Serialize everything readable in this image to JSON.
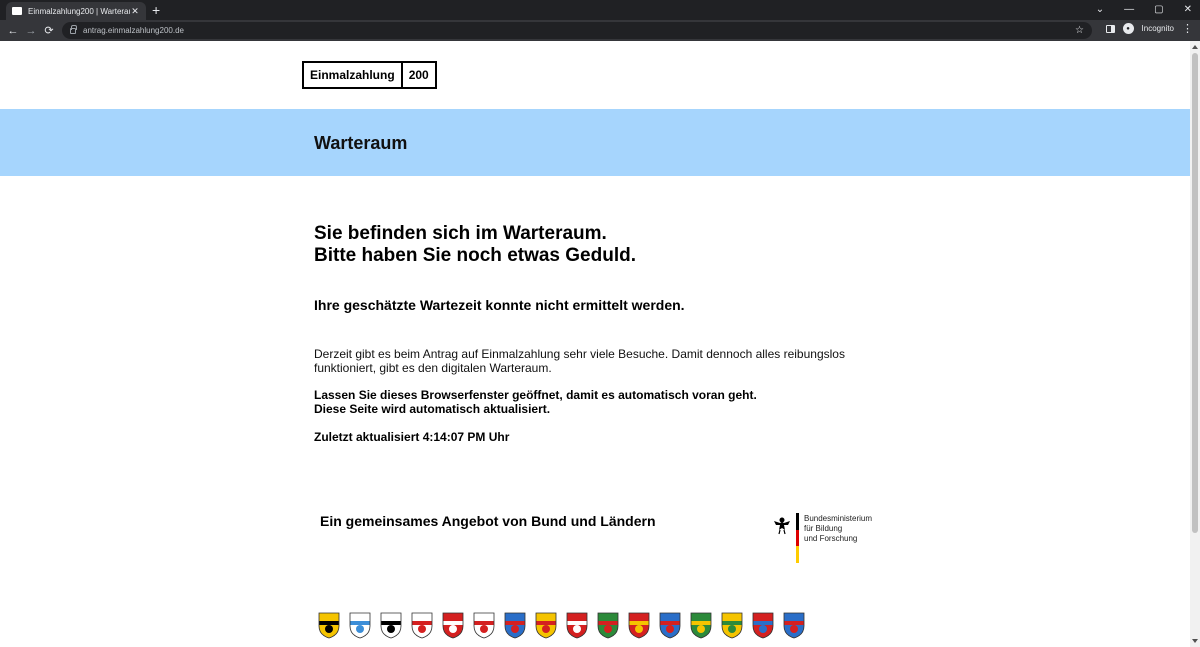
{
  "browser": {
    "tab_title": "Einmalzahlung200 | Warteraum",
    "tab_close": "✕",
    "new_tab": "+",
    "url": "antrag.einmalzahlung200.de",
    "incognito_label": "Incognito",
    "window_controls": [
      "⌄",
      "—",
      "▢",
      "✕"
    ],
    "nav": {
      "back": "←",
      "forward": "→",
      "reload": "⟳",
      "star": "☆",
      "menu": "⋮"
    }
  },
  "header": {
    "logo_word": "Einmalzahlung",
    "logo_number": "200"
  },
  "banner": {
    "title": "Warteraum"
  },
  "main": {
    "headline_line1": "Sie befinden sich im Warteraum.",
    "headline_line2": "Bitte haben Sie noch etwas Geduld.",
    "wait_estimate": "Ihre geschätzte Wartezeit konnte nicht ermittelt werden.",
    "info_text": "Derzeit gibt es beim Antrag auf Einmalzahlung sehr viele Besuche. Damit dennoch alles reibungslos funktioniert, gibt es den digitalen Warteraum.",
    "keep_open_line1": "Lassen Sie dieses Browserfenster geöffnet, damit es automatisch voran geht.",
    "keep_open_line2": "Diese Seite wird automatisch aktualisiert.",
    "last_updated": "Zuletzt aktualisiert 4:14:07 PM Uhr"
  },
  "footer": {
    "offer_text": "Ein gemeinsames Angebot von Bund und Ländern",
    "bmbf_line1": "Bundesministerium",
    "bmbf_line2": "für Bildung",
    "bmbf_line3": "und Forschung",
    "crests": [
      {
        "icon": "baden-wuerttemberg-crest-icon",
        "colors": [
          "#f5c400",
          "#000000"
        ]
      },
      {
        "icon": "bayern-crest-icon",
        "colors": [
          "#ffffff",
          "#3c8ed8"
        ]
      },
      {
        "icon": "berlin-crest-icon",
        "colors": [
          "#ffffff",
          "#000000"
        ]
      },
      {
        "icon": "brandenburg-crest-icon",
        "colors": [
          "#ffffff",
          "#d42020"
        ]
      },
      {
        "icon": "bremen-crest-icon",
        "colors": [
          "#d42020",
          "#ffffff"
        ]
      },
      {
        "icon": "hamburg-crest-icon",
        "colors": [
          "#ffffff",
          "#d42020"
        ]
      },
      {
        "icon": "hessen-crest-icon",
        "colors": [
          "#2a6ec8",
          "#d42020"
        ]
      },
      {
        "icon": "mecklenburg-vorpommern-crest-icon",
        "colors": [
          "#f5c400",
          "#d42020"
        ]
      },
      {
        "icon": "niedersachsen-crest-icon",
        "colors": [
          "#d42020",
          "#ffffff"
        ]
      },
      {
        "icon": "nordrhein-westfalen-crest-icon",
        "colors": [
          "#2c8a3a",
          "#d42020"
        ]
      },
      {
        "icon": "rheinland-pfalz-crest-icon",
        "colors": [
          "#d42020",
          "#f5c400"
        ]
      },
      {
        "icon": "saarland-crest-icon",
        "colors": [
          "#2a6ec8",
          "#d42020"
        ]
      },
      {
        "icon": "sachsen-crest-icon",
        "colors": [
          "#2c8a3a",
          "#f5c400"
        ]
      },
      {
        "icon": "sachsen-anhalt-crest-icon",
        "colors": [
          "#f5c400",
          "#2c8a3a"
        ]
      },
      {
        "icon": "schleswig-holstein-crest-icon",
        "colors": [
          "#d42020",
          "#2a6ec8"
        ]
      },
      {
        "icon": "thueringen-crest-icon",
        "colors": [
          "#2a6ec8",
          "#d42020"
        ]
      }
    ]
  },
  "colors": {
    "banner": "#a6d5fd"
  }
}
